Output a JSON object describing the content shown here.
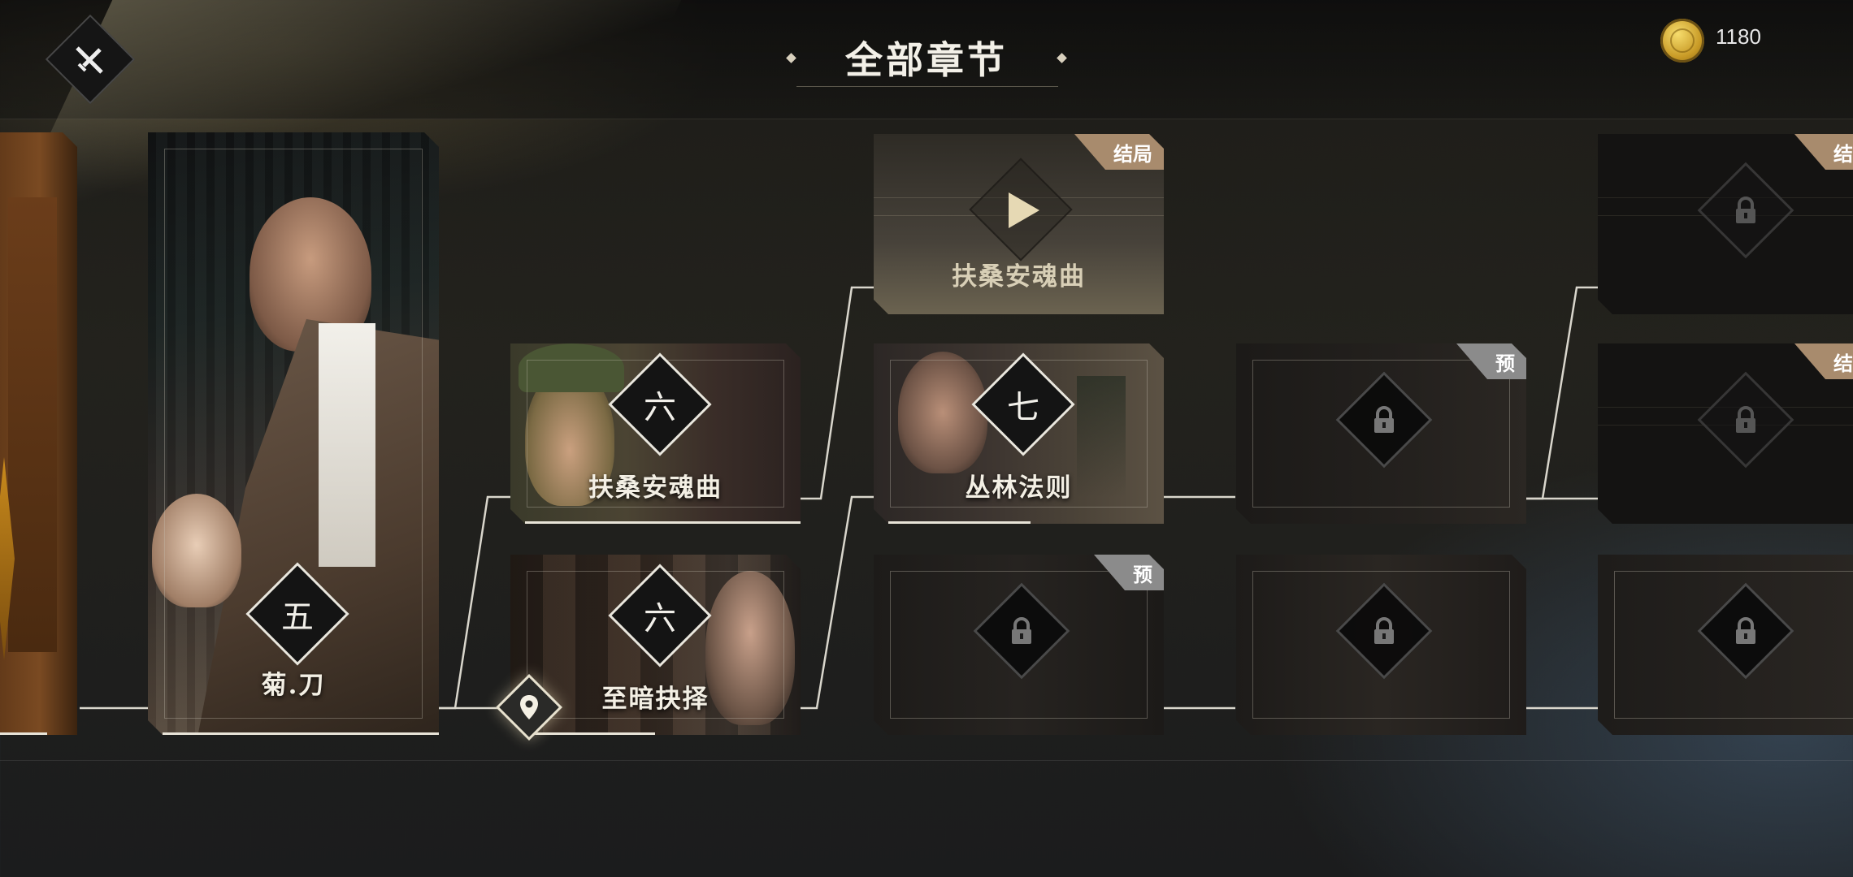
{
  "header": {
    "title": "全部章节",
    "coins": "1180"
  },
  "chapters": {
    "ch5": {
      "number": "五",
      "title": "菊.刀"
    },
    "ch6a": {
      "number": "六",
      "title": "扶桑安魂曲"
    },
    "ch6b": {
      "number": "六",
      "title": "至暗抉择"
    },
    "ending1": {
      "tag": "结局",
      "title": "扶桑安魂曲"
    },
    "ch7": {
      "number": "七",
      "title": "丛林法则"
    },
    "preview_tag": "预",
    "end_tag_partial": "结"
  },
  "colors": {
    "accent": "#a88b6d",
    "gold": "#c89a26",
    "preview": "#8b8b8b"
  },
  "icons": {
    "back": "crossed-swords-icon",
    "coin": "coin-icon",
    "play": "play-icon",
    "lock": "lock-icon",
    "location": "location-pin-icon"
  }
}
